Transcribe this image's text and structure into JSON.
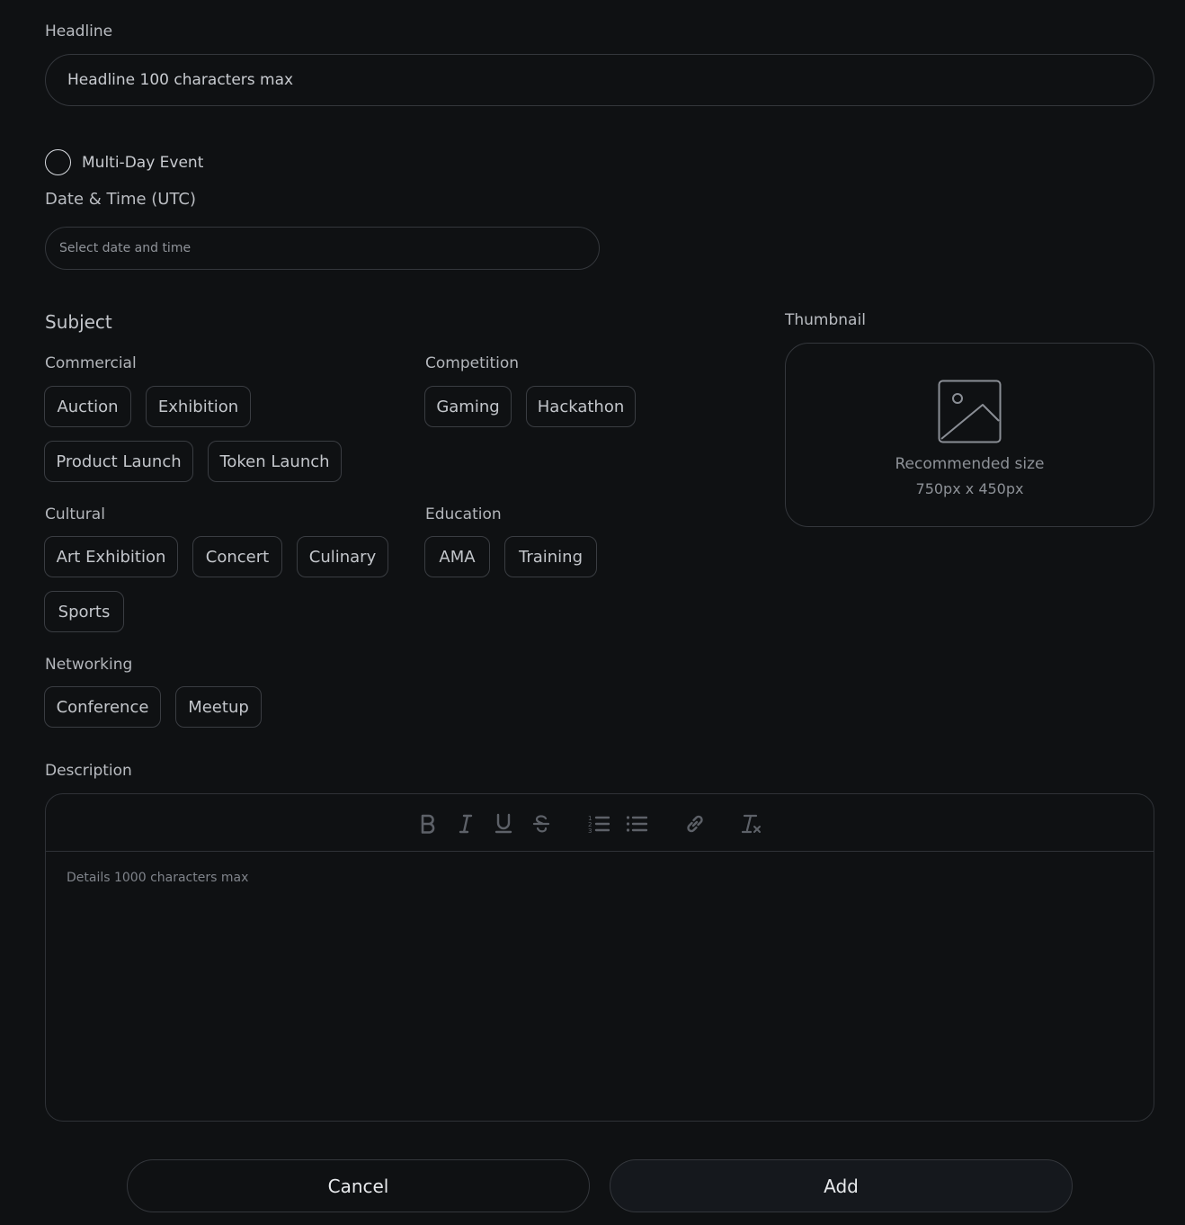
{
  "headline": {
    "label": "Headline",
    "placeholder": "Headline 100 characters max"
  },
  "multi_day": {
    "label": "Multi-Day Event",
    "checked": false
  },
  "date_time": {
    "label": "Date & Time (UTC)",
    "placeholder": "Select date and time"
  },
  "subject": {
    "title": "Subject",
    "groups": [
      {
        "name": "Commercial",
        "chips": [
          "Auction",
          "Exhibition",
          "Product Launch",
          "Token Launch"
        ]
      },
      {
        "name": "Competition",
        "chips": [
          "Gaming",
          "Hackathon"
        ]
      },
      {
        "name": "Cultural",
        "chips": [
          "Art Exhibition",
          "Concert",
          "Culinary",
          "Sports"
        ]
      },
      {
        "name": "Education",
        "chips": [
          "AMA",
          "Training"
        ]
      },
      {
        "name": "Networking",
        "chips": [
          "Conference",
          "Meetup"
        ]
      }
    ]
  },
  "thumbnail": {
    "label": "Thumbnail",
    "hint_line1": "Recommended size",
    "hint_line2": "750px x 450px",
    "icon": "image-placeholder-icon"
  },
  "description": {
    "label": "Description",
    "placeholder": "Details 1000 characters max",
    "toolbar": [
      "bold-icon",
      "italic-icon",
      "underline-icon",
      "strikethrough-icon",
      "ordered-list-icon",
      "bullet-list-icon",
      "link-icon",
      "clear-format-icon"
    ]
  },
  "actions": {
    "cancel_label": "Cancel",
    "add_label": "Add"
  },
  "colors": {
    "background": "#0f1113",
    "border": "#34373c",
    "text": "#c3c6cb",
    "add_button_bg": "#15181d"
  }
}
